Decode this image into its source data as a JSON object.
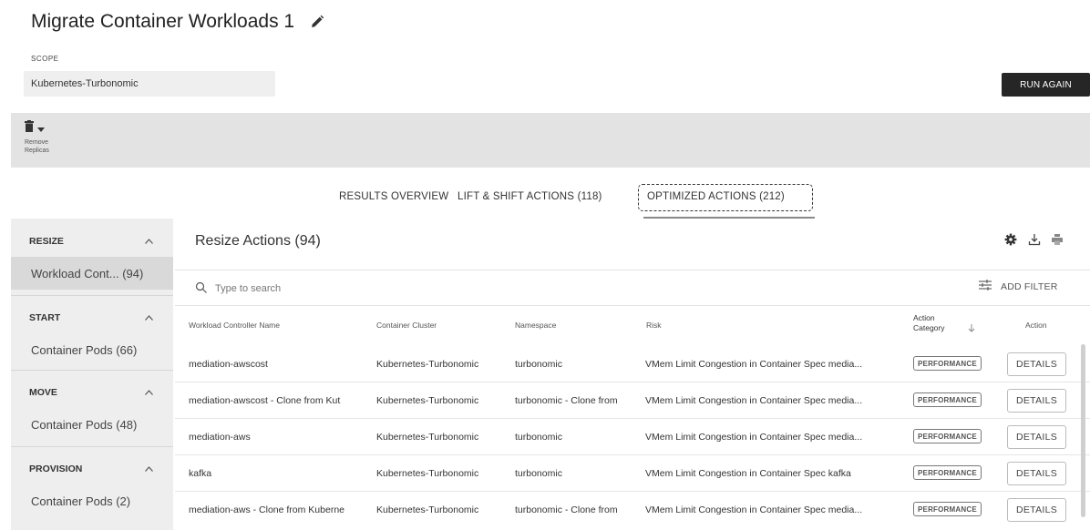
{
  "header": {
    "title": "Migrate Container Workloads 1",
    "scope_label": "SCOPE",
    "scope_value": "Kubernetes-Turbonomic",
    "run_again": "RUN AGAIN"
  },
  "toolbar": {
    "remove_line1": "Remove",
    "remove_line2": "Replicas"
  },
  "tabs": [
    {
      "label": "RESULTS OVERVIEW"
    },
    {
      "label": "LIFT & SHIFT ACTIONS (118)"
    },
    {
      "label": "OPTIMIZED ACTIONS (212)"
    }
  ],
  "sidebar": {
    "sections": [
      {
        "title": "RESIZE",
        "item": "Workload Cont... (94)"
      },
      {
        "title": "START",
        "item": "Container Pods (66)"
      },
      {
        "title": "MOVE",
        "item": "Container Pods (48)"
      },
      {
        "title": "PROVISION",
        "item": "Container Pods (2)"
      }
    ]
  },
  "panel": {
    "title": "Resize Actions (94)",
    "search_placeholder": "Type to search",
    "add_filter": "ADD FILTER"
  },
  "table": {
    "headers": {
      "name": "Workload Controller Name",
      "cluster": "Container Cluster",
      "namespace": "Namespace",
      "risk": "Risk",
      "category_line1": "Action",
      "category_line2": "Category",
      "action": "Action"
    },
    "rows": [
      {
        "name": "mediation-awscost",
        "cluster": "Kubernetes-Turbonomic",
        "namespace": "turbonomic",
        "risk": "VMem Limit Congestion in Container Spec media...",
        "category": "PERFORMANCE",
        "action": "DETAILS"
      },
      {
        "name": "mediation-awscost - Clone from Kut",
        "cluster": "Kubernetes-Turbonomic",
        "namespace": "turbonomic - Clone from",
        "risk": "VMem Limit Congestion in Container Spec media...",
        "category": "PERFORMANCE",
        "action": "DETAILS"
      },
      {
        "name": "mediation-aws",
        "cluster": "Kubernetes-Turbonomic",
        "namespace": "turbonomic",
        "risk": "VMem Limit Congestion in Container Spec media...",
        "category": "PERFORMANCE",
        "action": "DETAILS"
      },
      {
        "name": "kafka",
        "cluster": "Kubernetes-Turbonomic",
        "namespace": "turbonomic",
        "risk": "VMem Limit Congestion in Container Spec kafka",
        "category": "PERFORMANCE",
        "action": "DETAILS"
      },
      {
        "name": "mediation-aws - Clone from Kuberne",
        "cluster": "Kubernetes-Turbonomic",
        "namespace": "turbonomic - Clone from",
        "risk": "VMem Limit Congestion in Container Spec media...",
        "category": "PERFORMANCE",
        "action": "DETAILS"
      }
    ]
  }
}
